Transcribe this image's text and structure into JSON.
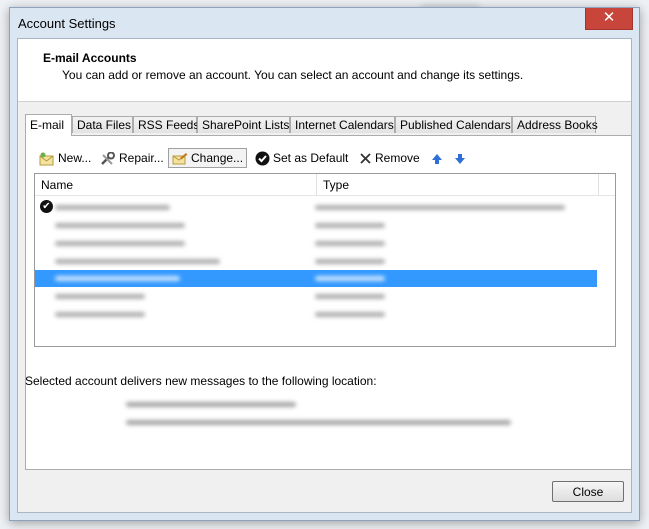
{
  "window": {
    "title": "Account Settings",
    "close_glyph": "✕"
  },
  "header": {
    "title": "E-mail Accounts",
    "description": "You can add or remove an account. You can select an account and change its settings."
  },
  "tabs": [
    {
      "label": "E-mail",
      "active": true
    },
    {
      "label": "Data Files"
    },
    {
      "label": "RSS Feeds"
    },
    {
      "label": "SharePoint Lists"
    },
    {
      "label": "Internet Calendars"
    },
    {
      "label": "Published Calendars"
    },
    {
      "label": "Address Books"
    }
  ],
  "toolbar": {
    "new": "New...",
    "repair": "Repair...",
    "change": "Change...",
    "set_default": "Set as Default",
    "remove": "Remove",
    "icons": {
      "new": "new-account-icon",
      "repair": "wrench-icon",
      "change": "change-icon",
      "set_default": "checkmark-circle-icon",
      "remove": "x-icon",
      "move_up": "arrow-up-icon",
      "move_down": "arrow-down-icon"
    }
  },
  "account_list": {
    "columns": [
      "Name",
      "Type"
    ],
    "default_mark": "✔",
    "selected_row_index": 4,
    "selection_color": "#3399ff"
  },
  "delivery": {
    "label": "Selected account delivers new messages to the following location:"
  },
  "footer": {
    "close": "Close"
  }
}
